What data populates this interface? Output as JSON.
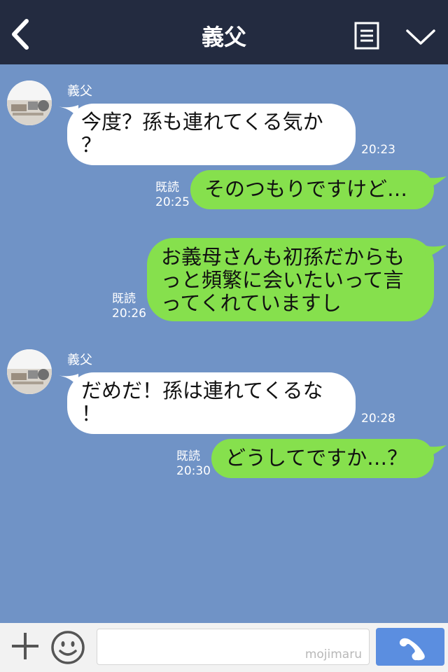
{
  "header": {
    "title": "義父"
  },
  "messages": [
    {
      "sender": "義父",
      "text_lines": [
        "今度？孫も連れてくる気か",
        "？"
      ],
      "time": "20:23"
    },
    {
      "read": "既読",
      "text": "そのつもりですけど…",
      "time": "20:25"
    },
    {
      "read": "既読",
      "text_lines": [
        "お義母さんも初孫だからも",
        "っと頻繁に会いたいって言",
        "ってくれていますし"
      ],
      "time": "20:26"
    },
    {
      "sender": "義父",
      "text_lines": [
        "だめだ！孫は連れてくるな",
        "！"
      ],
      "time": "20:28"
    },
    {
      "read": "既読",
      "text": "どうしてですか…？",
      "time": "20:30"
    }
  ],
  "footer": {
    "watermark": "mojimaru"
  },
  "colors": {
    "header_bg": "#232b40",
    "chat_bg": "#7093c6",
    "bubble_green": "#86e04d",
    "bubble_white": "#ffffff",
    "send_button": "#5b8ee0"
  },
  "icons": [
    "back-arrow-icon",
    "menu-list-icon",
    "chevron-down-icon",
    "plus-icon",
    "emoji-icon",
    "phone-icon"
  ]
}
